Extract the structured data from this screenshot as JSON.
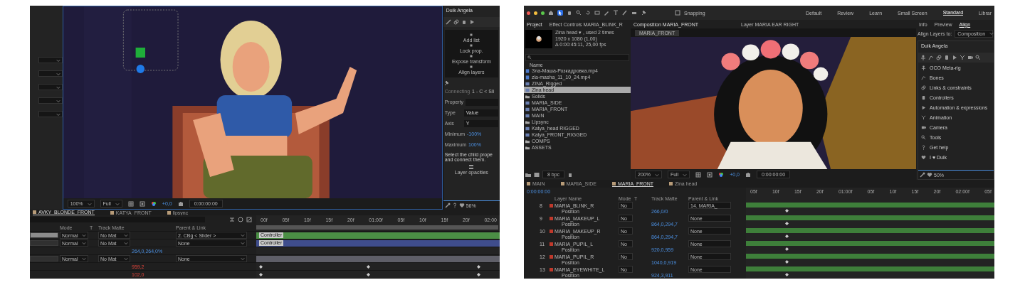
{
  "left_screen": {
    "viewer_toolbar": {
      "zoom": "100%",
      "resolution": "Full",
      "exposure": "+0,0",
      "timecode": "0:00:00:00"
    },
    "duik_panel": {
      "title": "Duik Angela",
      "actions": [
        "Add list",
        "Lock prop.",
        "Expose transform",
        "Align layers"
      ],
      "connecting_label": "Connecting",
      "connecting_value": "1 - C < Sli",
      "fields": [
        {
          "label": "Property",
          "kind": "empty"
        },
        {
          "label": "Type",
          "value": "Value",
          "kind": "select"
        },
        {
          "label": "Axis",
          "value": "Y",
          "kind": "select"
        },
        {
          "label": "Minimum",
          "value": "-100%",
          "kind": "number"
        },
        {
          "label": "Maximum",
          "value": "100%",
          "kind": "number"
        }
      ],
      "hint_lines": [
        "Select the child prope",
        "and connect them."
      ],
      "button": "Layer opacities",
      "footer_zoom": "56%"
    },
    "timeline": {
      "tabs": [
        {
          "label": "AVKY_BLONDE_FRONT",
          "selected": true
        },
        {
          "label": "KATYA_FRONT",
          "selected": false
        },
        {
          "label": "lipsync",
          "selected": false
        }
      ],
      "columns": [
        "Mode",
        "T",
        "Track Matte",
        "Parent & Link"
      ],
      "ruler": [
        "00f",
        "05f",
        "10f",
        "15f",
        "20f",
        "01:00f",
        "05f",
        "10f",
        "15f",
        "20f",
        "02:00"
      ],
      "rows": [
        {
          "kind": "layer",
          "mode": "Normal",
          "matte": "No Mat",
          "parent": "2. CBg < Slider >",
          "selected": true,
          "bar_label": "Controller",
          "color": "#4b8f45"
        },
        {
          "kind": "layer",
          "mode": "Normal",
          "matte": "No Mat",
          "parent": "None",
          "selected": false,
          "bar_label": "Controller",
          "color": "#3f4d8c"
        },
        {
          "kind": "property",
          "value": "264,0,264,0%",
          "keyed": false
        },
        {
          "kind": "layer",
          "mode": "Normal",
          "matte": "No Mat",
          "parent": "None",
          "selected": false,
          "color": "#5f5f68"
        },
        {
          "kind": "property",
          "value": "959,2",
          "keyed": true
        },
        {
          "kind": "property",
          "value": "102,0",
          "keyed": true
        }
      ]
    }
  },
  "right_screen": {
    "top_bar": {
      "snapping": "Snapping",
      "workspaces": [
        {
          "label": "Default",
          "selected": false
        },
        {
          "label": "Review",
          "selected": false
        },
        {
          "label": "Learn",
          "selected": false
        },
        {
          "label": "Small Screen",
          "selected": false
        },
        {
          "label": "Standard",
          "selected": true
        },
        {
          "label": "Librar",
          "selected": false
        }
      ]
    },
    "panel_tabs": {
      "project": "Project",
      "effect_controls": "Effect Controls MARIA_BLINK_R",
      "composition": "Composition MARIA_FRONT",
      "layer": "Layer MARIA EAR RIGHT",
      "side": [
        {
          "label": "Info",
          "selected": false
        },
        {
          "label": "Preview",
          "selected": false
        },
        {
          "label": "Align",
          "selected": true
        }
      ]
    },
    "project": {
      "info_lines": [
        "Zina head ▾ , used 2 times",
        "1920 x 1080 (1,00)",
        "Δ 0:00:45:11, 25,00 fps"
      ],
      "name_header": "Name",
      "bit_depth": "8 bpc",
      "items": [
        {
          "name": "Зла-Маша-Розкадровка.mp4",
          "kind": "video",
          "selected": false
        },
        {
          "name": "zla-masha_11_10_24.mp4",
          "kind": "video",
          "selected": false
        },
        {
          "name": "ZINA_Rigged",
          "kind": "comp",
          "selected": false
        },
        {
          "name": "Zina head",
          "kind": "comp",
          "selected": true
        },
        {
          "name": "Solids",
          "kind": "folder",
          "selected": false
        },
        {
          "name": "MARIA_SIDE",
          "kind": "comp",
          "selected": false
        },
        {
          "name": "MARIA_FRONT",
          "kind": "comp",
          "selected": false
        },
        {
          "name": "MAIN",
          "kind": "comp",
          "selected": false
        },
        {
          "name": "Lipsync",
          "kind": "folder",
          "selected": false
        },
        {
          "name": "Katya_head RIGGED",
          "kind": "comp",
          "selected": false
        },
        {
          "name": "Katya_FRONT_RIGGED",
          "kind": "comp",
          "selected": false
        },
        {
          "name": "COMPS",
          "kind": "folder",
          "selected": false
        },
        {
          "name": "ASSETS",
          "kind": "folder",
          "selected": false
        }
      ]
    },
    "viewer": {
      "breadcrumb": "MARIA_FRONT",
      "zoom": "200%",
      "resolution": "Full",
      "exposure": "+0,0",
      "timecode": "0:00:00:00"
    },
    "align": {
      "label": "Align Layers to:",
      "value": "Composition"
    },
    "duik_panel": {
      "title": "Duik Angela",
      "items": [
        "OCO Meta-rig",
        "Bones",
        "Links & constraints",
        "Controllers",
        "Automation & expressions",
        "Animation",
        "Camera",
        "Tools",
        "Get help",
        "I ♥ Duik"
      ],
      "footer_zoom": "50%"
    },
    "timeline": {
      "tabs": [
        {
          "label": "MAIN",
          "selected": false
        },
        {
          "label": "MARIA_SIDE",
          "selected": false
        },
        {
          "label": "MARIA_FRONT",
          "selected": true
        },
        {
          "label": "Zina head",
          "selected": false
        }
      ],
      "timecode": "0:00:00:00",
      "columns": [
        "Layer Name",
        "Mode",
        "T",
        "Track Matte",
        "Parent & Link"
      ],
      "ruler": [
        "05f",
        "10f",
        "15f",
        "20f",
        "01:00f",
        "05f",
        "10f",
        "15f",
        "20f",
        "02:00f",
        "05f"
      ],
      "rows": [
        {
          "kind": "layer",
          "index": "8",
          "name": "MARIA_BLINK_R",
          "mode": "No",
          "parent": "14. MARIA_"
        },
        {
          "kind": "property",
          "name": "Position",
          "value": "266,0/0"
        },
        {
          "kind": "layer",
          "index": "9",
          "name": "MARIA_MAKEUP_L",
          "mode": "No",
          "parent": "None"
        },
        {
          "kind": "property",
          "name": "Position",
          "value": "864,0,294,7"
        },
        {
          "kind": "layer",
          "index": "10",
          "name": "MARIA_MAKEUP_R",
          "mode": "No",
          "parent": "None"
        },
        {
          "kind": "property",
          "name": "Position",
          "value": "864,0,294,7"
        },
        {
          "kind": "layer",
          "index": "11",
          "name": "MARIA_PUPIL_L",
          "mode": "No",
          "parent": "None"
        },
        {
          "kind": "property",
          "name": "Position",
          "value": "920,0,959"
        },
        {
          "kind": "layer",
          "index": "12",
          "name": "MARIA_PUPIL_R",
          "mode": "No",
          "parent": "None"
        },
        {
          "kind": "property",
          "name": "Position",
          "value": "1040,0,919"
        },
        {
          "kind": "layer",
          "index": "13",
          "name": "MARIA_EYEWHITE_L",
          "mode": "No",
          "parent": "None"
        },
        {
          "kind": "property",
          "name": "Position",
          "value": "924,3,911"
        }
      ]
    }
  }
}
